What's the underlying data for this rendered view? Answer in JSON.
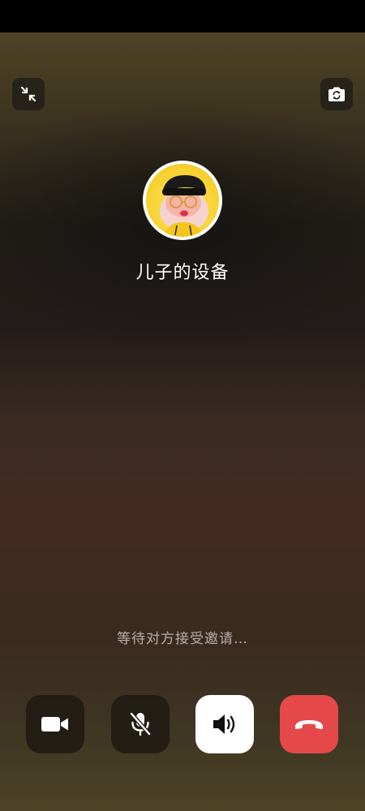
{
  "call": {
    "contact_name": "儿子的设备",
    "status_text": "等待对方接受邀请…"
  },
  "icons": {
    "minimize": "minimize-icon",
    "flip_camera": "flip-camera-icon",
    "video": "video-camera-icon",
    "mute": "microphone-muted-icon",
    "speaker": "speaker-icon",
    "hangup": "hang-up-icon"
  },
  "colors": {
    "hangup": "#e5494a",
    "speaker_bg": "#ffffff",
    "avatar_bg": "#f7cf2e"
  }
}
